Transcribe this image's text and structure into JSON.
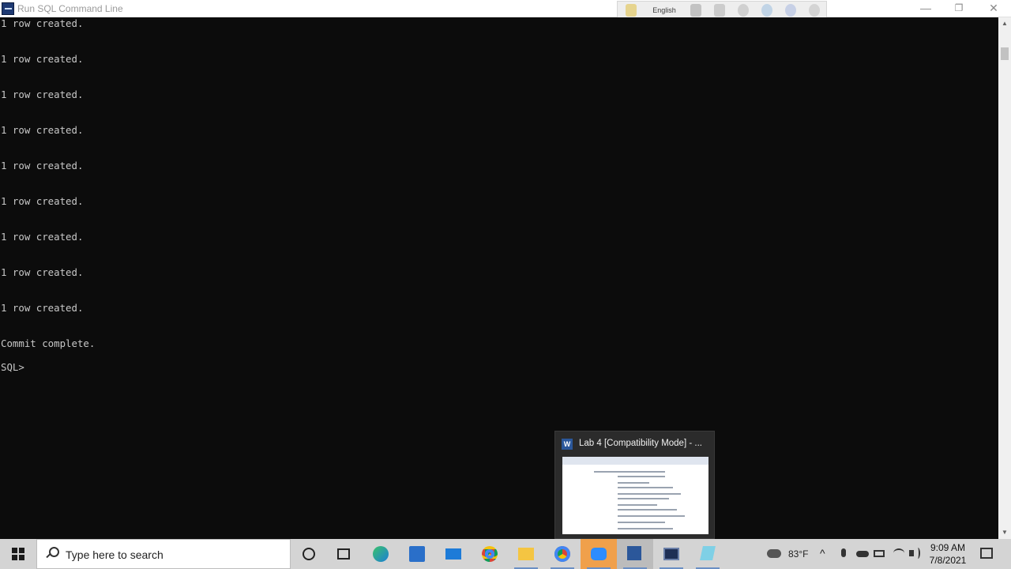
{
  "window": {
    "title": "Run SQL Command Line",
    "min_label": "—",
    "max_label": "❐",
    "close_label": "✕"
  },
  "langbar": {
    "language": "English"
  },
  "console": {
    "lines": [
      "1 row created.",
      "1 row created.",
      "1 row created.",
      "1 row created.",
      "1 row created.",
      "1 row created.",
      "1 row created.",
      "1 row created.",
      "1 row created.",
      "Commit complete.",
      "SQL>"
    ]
  },
  "preview": {
    "title": "Lab 4 [Compatibility Mode] - ...",
    "app_letter": "W"
  },
  "taskbar": {
    "search_placeholder": "Type here to search",
    "weather": "83°F",
    "time": "9:09 AM",
    "date": "7/8/2021"
  },
  "colors": {
    "console_bg": "#0c0c0c",
    "console_text": "#c8c8c8",
    "taskbar_bg": "#d4d4d4",
    "zoom_accent": "#f0a04b",
    "word_blue": "#2b579a"
  }
}
